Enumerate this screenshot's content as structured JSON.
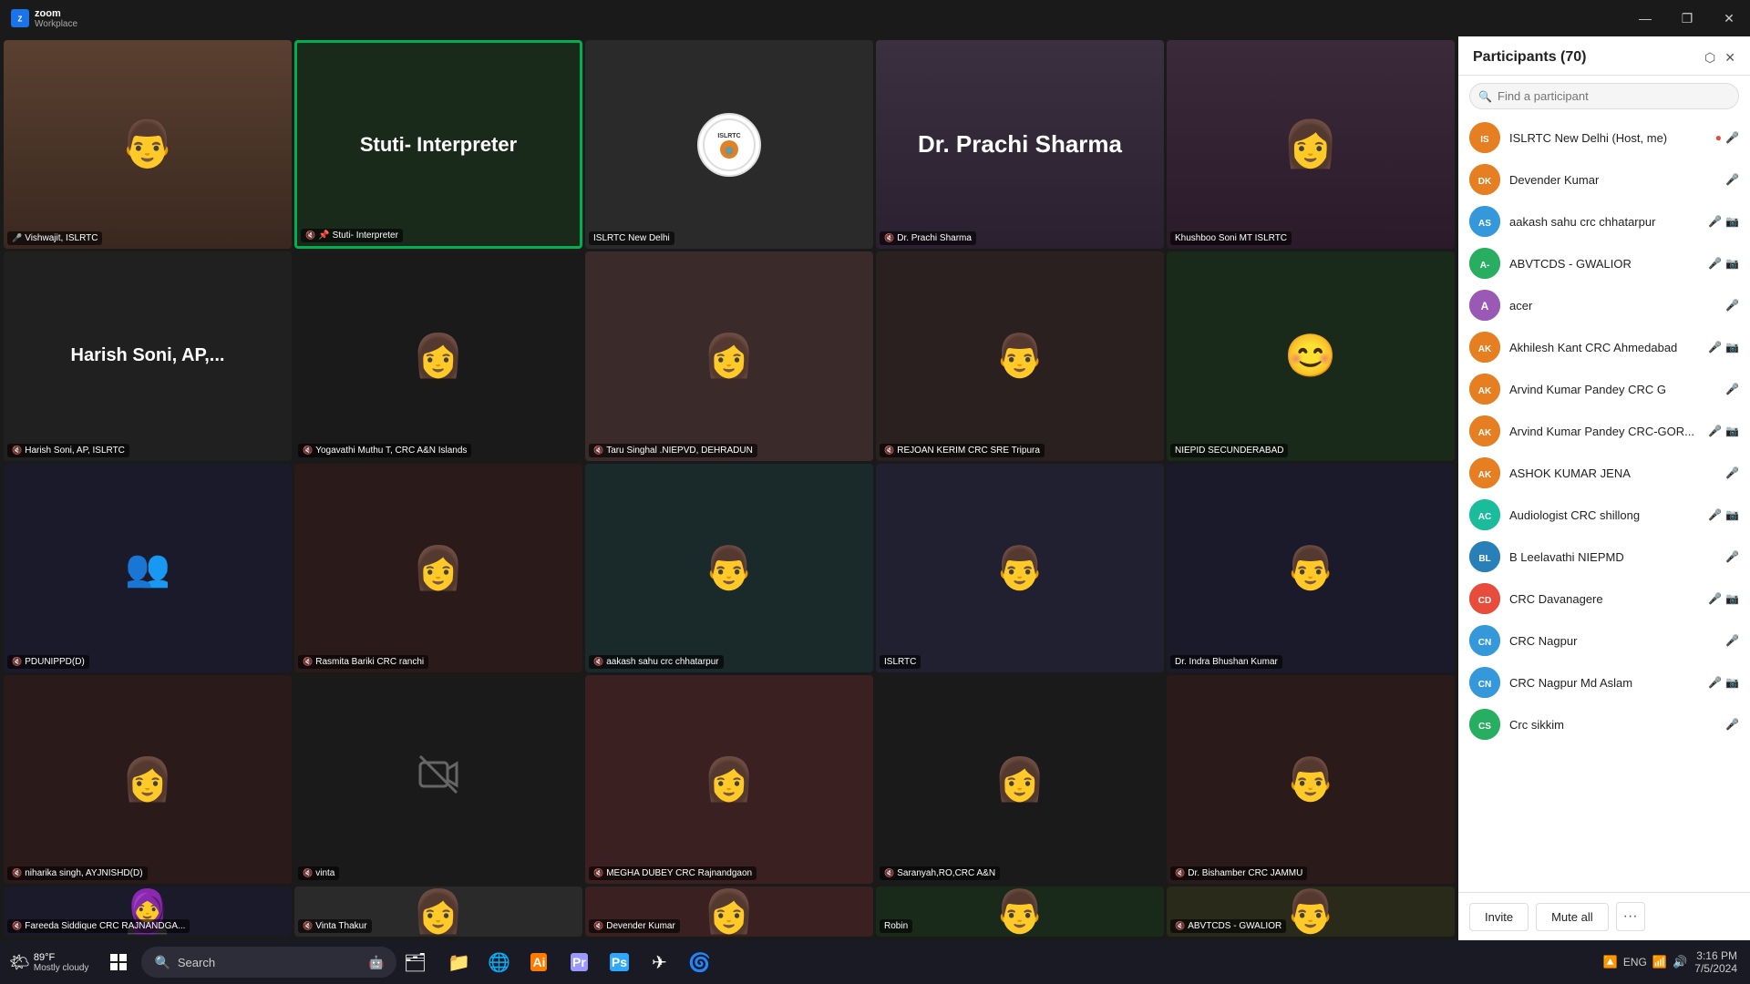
{
  "app": {
    "title": "zoom",
    "subtitle": "Workplace"
  },
  "window_controls": {
    "minimize": "—",
    "maximize": "❐",
    "close": "✕"
  },
  "participants_panel": {
    "title": "Participants (70)",
    "search_placeholder": "Find a participant",
    "invite_btn": "Invite",
    "mute_all_btn": "Mute all",
    "more_btn": "···",
    "participants": [
      {
        "initials": "IS",
        "name": "ISLRTC New Delhi (Host, me)",
        "color": "#e67e22",
        "is_host": true,
        "mic_on": true,
        "cam_on": true,
        "muted": false,
        "avatar_img": true
      },
      {
        "initials": "DK",
        "name": "Devender Kumar",
        "color": "#e67e22",
        "muted": true,
        "cam_on": false
      },
      {
        "initials": "AS",
        "name": "aakash sahu crc chhatarpur",
        "color": "#3498db",
        "muted": true,
        "cam_on": false
      },
      {
        "initials": "A-",
        "name": "ABVTCDS - GWALIOR",
        "color": "#2ecc71",
        "muted": true,
        "cam_on": false
      },
      {
        "initials": "A",
        "name": "acer",
        "color": "#9b59b6",
        "muted": true,
        "cam_on": false
      },
      {
        "initials": "AK",
        "name": "Akhilesh Kant CRC Ahmedabad",
        "color": "#e67e22",
        "muted": true,
        "cam_on": true
      },
      {
        "initials": "AK",
        "name": "Arvind Kumar Pandey CRC G",
        "color": "#e67e22",
        "muted": true,
        "cam_on": false
      },
      {
        "initials": "AK",
        "name": "Arvind Kumar Pandey CRC-GOR...",
        "color": "#e67e22",
        "muted": true,
        "cam_on": true
      },
      {
        "initials": "AK",
        "name": "ASHOK KUMAR JENA",
        "color": "#e67e22",
        "muted": true,
        "cam_on": false
      },
      {
        "initials": "AC",
        "name": "Audiologist CRC shillong",
        "color": "#1abc9c",
        "muted": true,
        "cam_on": true
      },
      {
        "initials": "BL",
        "name": "B Leelavathi NIEPMD",
        "color": "#2980b9",
        "muted": true,
        "cam_on": false
      },
      {
        "initials": "CD",
        "name": "CRC Davanagere",
        "color": "#e74c3c",
        "muted": true,
        "cam_on": false
      },
      {
        "initials": "CN",
        "name": "CRC Nagpur",
        "color": "#3498db",
        "muted": true,
        "cam_on": false
      },
      {
        "initials": "CN",
        "name": "CRC Nagpur Md Aslam",
        "color": "#3498db",
        "muted": true,
        "cam_on": true
      },
      {
        "initials": "CS",
        "name": "Crc sikkim",
        "color": "#27ae60",
        "muted": true,
        "cam_on": false
      }
    ]
  },
  "video_tiles": [
    {
      "id": 1,
      "name": "Vishwajit, ISLRTC",
      "label": "Vishwajit, ISLRTC",
      "type": "person",
      "bg": "#3a3020",
      "muted": true,
      "row": 1,
      "col": 1
    },
    {
      "id": 2,
      "name": "Stuti- Interpreter",
      "label": "Stuti- Interpreter",
      "type": "label",
      "bg": "#1a2a1a",
      "muted": true,
      "pinned": true,
      "row": 1,
      "col": 2
    },
    {
      "id": 3,
      "name": "ISLRTC New Delhi",
      "label": "ISLRTC New Delhi",
      "type": "logo",
      "bg": "#2a2a2a",
      "muted": false,
      "row": 1,
      "col": 3
    },
    {
      "id": 4,
      "name": "Dr. Prachi Sharma",
      "label": "Dr. Prachi Sharma",
      "type": "label",
      "bg": "#2a2030",
      "muted": true,
      "row": 1,
      "col": 4
    },
    {
      "id": 5,
      "name": "Khushboo Soni MT ISLRTC",
      "label": "Khushboo Soni MT ISLRTC",
      "type": "person",
      "bg": "#2a1a2a",
      "muted": false,
      "row": 1,
      "col": 5
    },
    {
      "id": 6,
      "name": "Harish Soni, AP,...",
      "label": "Harish Soni, AP, ISLRTC",
      "type": "label",
      "bg": "#202020",
      "muted": true,
      "row": 2,
      "col": 1
    },
    {
      "id": 7,
      "name": "Yogavathi Muthu T, CRC A&N Islands",
      "label": "Yogavathi Muthu T, CRC A&N Islands",
      "type": "person",
      "bg": "#1a1a1a",
      "muted": true,
      "row": 2,
      "col": 2
    },
    {
      "id": 8,
      "name": "Taru Singhal .NIEPVD, DEHRADUN",
      "label": "Taru Singhal .NIEPVD, DEHRADUN",
      "type": "person",
      "bg": "#3a2a2a",
      "muted": true,
      "row": 2,
      "col": 3
    },
    {
      "id": 9,
      "name": "REJOAN KERIM CRC SRE Tripura",
      "label": "REJOAN KERIM CRC SRE Tripura",
      "type": "person",
      "bg": "#2a1818",
      "muted": true,
      "row": 2,
      "col": 4
    },
    {
      "id": 10,
      "name": "NIEPID SECUNDERABAD",
      "label": "NIEPID SECUNDERABAD",
      "type": "person",
      "bg": "#1a2a1a",
      "muted": false,
      "row": 2,
      "col": 5
    },
    {
      "id": 11,
      "name": "PDUNIPPD(D)",
      "label": "PDUNIPPD(D)",
      "type": "person",
      "bg": "#1a1a2a",
      "muted": true,
      "row": 3,
      "col": 1
    },
    {
      "id": 12,
      "name": "Rasmita Bariki CRC ranchi",
      "label": "Rasmita Bariki CRC ranchi",
      "type": "person",
      "bg": "#2a1a1a",
      "muted": true,
      "row": 3,
      "col": 2
    },
    {
      "id": 13,
      "name": "aakash sahu crc chhatarpur",
      "label": "aakash sahu crc chhatarpur",
      "type": "person",
      "bg": "#1a2a2a",
      "muted": true,
      "row": 3,
      "col": 3
    },
    {
      "id": 14,
      "name": "ISLRTC",
      "label": "ISLRTC",
      "type": "person",
      "bg": "#202030",
      "muted": false,
      "row": 3,
      "col": 4
    },
    {
      "id": 15,
      "name": "Dr. Indra Bhushan Kumar",
      "label": "Dr. Indra Bhushan Kumar",
      "type": "person",
      "bg": "#1a1a2a",
      "muted": false,
      "row": 3,
      "col": 5
    },
    {
      "id": 16,
      "name": "niharika singh, AYJNISHD(D)",
      "label": "niharika singh, AYJNISHD(D)",
      "type": "person",
      "bg": "#2a1a1a",
      "muted": true,
      "row": 4,
      "col": 1
    },
    {
      "id": 17,
      "name": "vinta",
      "label": "vinta",
      "type": "camera-off",
      "bg": "#1a1a1a",
      "muted": true,
      "row": 4,
      "col": 2
    },
    {
      "id": 18,
      "name": "MEGHA DUBEY CRC Rajnandgaon",
      "label": "MEGHA DUBEY CRC Rajnandgaon",
      "type": "person",
      "bg": "#3a2020",
      "muted": true,
      "row": 4,
      "col": 3
    },
    {
      "id": 19,
      "name": "Saranyah,RO,CRC A&N",
      "label": "Saranyah,RO,CRC A&N",
      "type": "person",
      "bg": "#1a1a1a",
      "muted": true,
      "row": 4,
      "col": 4
    },
    {
      "id": 20,
      "name": "Dr. Bishamber CRC JAMMU",
      "label": "Dr. Bishamber CRC JAMMU",
      "type": "person",
      "bg": "#2a1a1a",
      "muted": true,
      "row": 4,
      "col": 5
    },
    {
      "id": 21,
      "name": "Fareeda Siddique CRC RAJNANDGA...",
      "label": "Fareeda Siddique CRC RAJNANDGA...",
      "type": "person",
      "bg": "#1a1a2a",
      "muted": true,
      "row": 5,
      "col": 1
    },
    {
      "id": 22,
      "name": "Vinta Thakur",
      "label": "Vinta Thakur",
      "type": "person",
      "bg": "#2a2a2a",
      "muted": true,
      "row": 5,
      "col": 2
    },
    {
      "id": 23,
      "name": "Devender Kumar",
      "label": "Devender Kumar",
      "type": "person",
      "bg": "#3a2020",
      "muted": true,
      "row": 5,
      "col": 3
    },
    {
      "id": 24,
      "name": "Robin",
      "label": "Robin",
      "type": "person",
      "bg": "#1a2a1a",
      "muted": false,
      "row": 5,
      "col": 4
    },
    {
      "id": 25,
      "name": "ABVTCDS - GWALIOR",
      "label": "ABVTCDS - GWALIOR",
      "type": "person",
      "bg": "#2a2a1a",
      "muted": true,
      "row": 5,
      "col": 5
    }
  ],
  "taskbar": {
    "weather_temp": "89°F",
    "weather_desc": "Mostly cloudy",
    "search_label": "Search",
    "time": "3:16 PM",
    "date": "7/5/2024",
    "lang": "ENG"
  }
}
